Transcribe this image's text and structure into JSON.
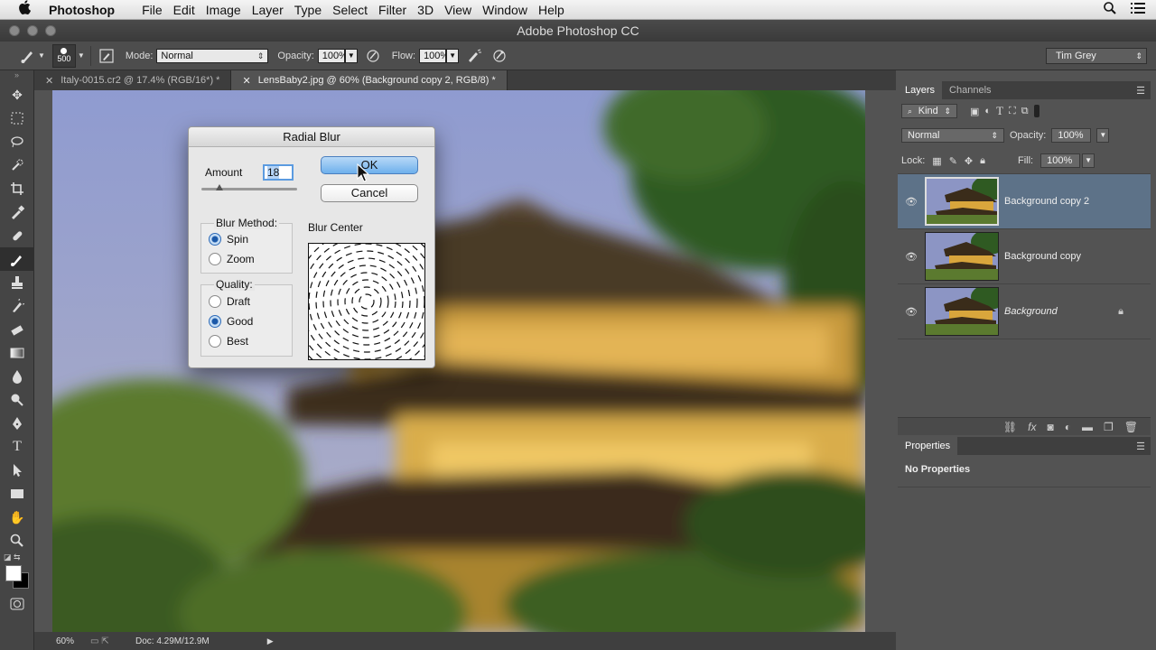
{
  "menubar": {
    "apple": "",
    "app_name": "Photoshop",
    "items": [
      "File",
      "Edit",
      "Image",
      "Layer",
      "Type",
      "Select",
      "Filter",
      "3D",
      "View",
      "Window",
      "Help"
    ]
  },
  "window": {
    "title": "Adobe Photoshop CC"
  },
  "options_bar": {
    "brush_size": "500",
    "mode_label": "Mode:",
    "mode_value": "Normal",
    "opacity_label": "Opacity:",
    "opacity_value": "100%",
    "flow_label": "Flow:",
    "flow_value": "100%",
    "workspace": "Tim Grey"
  },
  "doc_tabs": [
    {
      "label": "Italy-0015.cr2 @ 17.4% (RGB/16*) *",
      "active": false
    },
    {
      "label": "LensBaby2.jpg @ 60% (Background copy 2, RGB/8) *",
      "active": true
    }
  ],
  "status_bar": {
    "zoom": "60%",
    "doc_size": "Doc: 4.29M/12.9M"
  },
  "dialog": {
    "title": "Radial Blur",
    "amount_label": "Amount",
    "amount_value": "18",
    "ok_label": "OK",
    "cancel_label": "Cancel",
    "blur_method_label": "Blur Method:",
    "blur_methods": [
      "Spin",
      "Zoom"
    ],
    "blur_method_selected": "Spin",
    "quality_label": "Quality:",
    "qualities": [
      "Draft",
      "Good",
      "Best"
    ],
    "quality_selected": "Good",
    "blur_center_label": "Blur Center"
  },
  "layers_panel": {
    "tabs": [
      "Layers",
      "Channels"
    ],
    "kind_label": "Kind",
    "blend_mode": "Normal",
    "opacity_label": "Opacity:",
    "opacity_value": "100%",
    "lock_label": "Lock:",
    "fill_label": "Fill:",
    "fill_value": "100%",
    "layers": [
      {
        "name": "Background copy 2",
        "selected": true,
        "italic": false,
        "locked": false
      },
      {
        "name": "Background copy",
        "selected": false,
        "italic": false,
        "locked": false
      },
      {
        "name": "Background",
        "selected": false,
        "italic": true,
        "locked": true
      }
    ]
  },
  "properties_panel": {
    "tab": "Properties",
    "message": "No Properties"
  },
  "colors": {
    "accent": "#5d7288",
    "dialog_default": "#6eb0ec"
  }
}
